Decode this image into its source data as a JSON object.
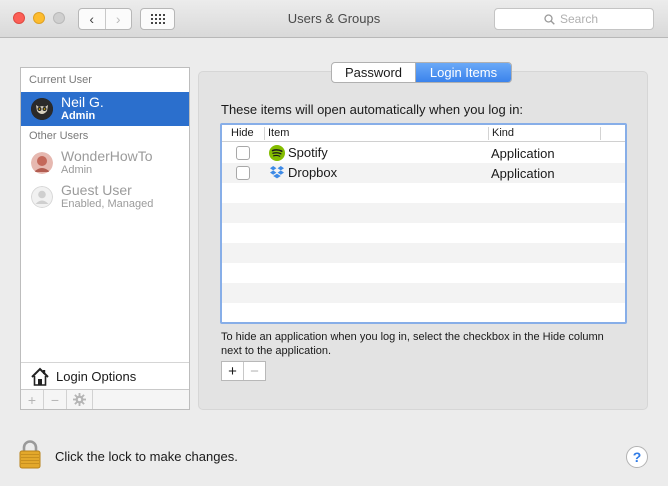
{
  "window": {
    "title": "Users & Groups",
    "back_glyph": "‹",
    "forward_glyph": "›",
    "search_placeholder": "Search"
  },
  "sidebar": {
    "current_user_header": "Current User",
    "other_users_header": "Other Users",
    "current_user": {
      "name": "Neil G.",
      "role": "Admin"
    },
    "other_users": [
      {
        "name": "WonderHowTo",
        "role": "Admin"
      },
      {
        "name": "Guest User",
        "role": "Enabled, Managed"
      }
    ],
    "login_options_label": "Login Options",
    "toolbar": {
      "add": "+",
      "remove": "−"
    }
  },
  "tabs": {
    "password": "Password",
    "login_items": "Login Items",
    "selected": "login_items"
  },
  "login_items": {
    "intro": "These items will open automatically when you log in:",
    "columns": {
      "hide": "Hide",
      "item": "Item",
      "kind": "Kind"
    },
    "rows": [
      {
        "hide": false,
        "name": "Spotify",
        "kind": "Application",
        "icon": "spotify-icon"
      },
      {
        "hide": false,
        "name": "Dropbox",
        "kind": "Application",
        "icon": "dropbox-icon"
      }
    ],
    "hint": "To hide an application when you log in, select the checkbox in the Hide column next to the application.",
    "add": "+",
    "remove": "−"
  },
  "footer": {
    "lock_text": "Click the lock to make changes.",
    "help": "?"
  },
  "colors": {
    "selection_blue": "#2b6fcd",
    "tab_selected": "#3b83ec",
    "spotify_green": "#84bd00",
    "dropbox_blue": "#3d8ae6",
    "lock_gold": "#e3a82b"
  }
}
